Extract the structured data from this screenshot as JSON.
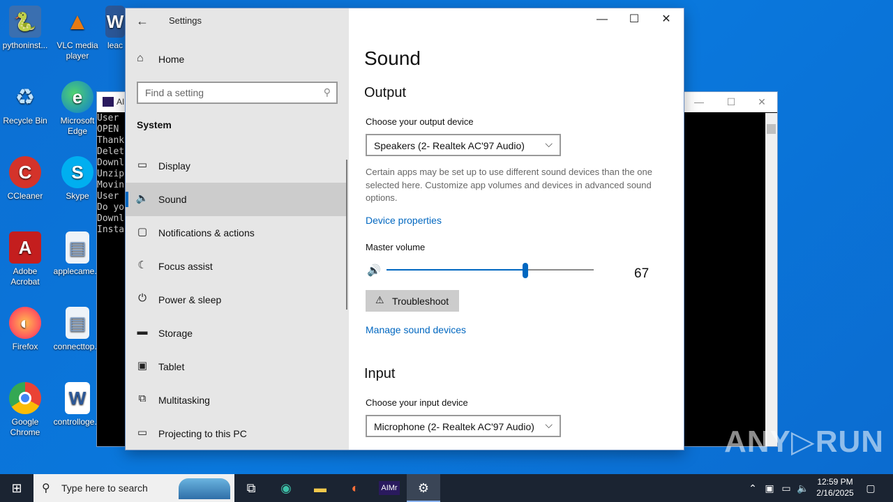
{
  "desktop": {
    "icons": [
      {
        "label": "pythoninst...",
        "glyph": "🐍",
        "color": "#3a6fb0"
      },
      {
        "label": "VLC media player",
        "glyph": "▲",
        "color": "#e87a12"
      },
      {
        "label": "leac",
        "glyph": "W",
        "color": "#2b5797"
      },
      {
        "label": "Recycle Bin",
        "glyph": "♻",
        "color": "#5aa0d8"
      },
      {
        "label": "Microsoft Edge",
        "glyph": "e",
        "color": "#1a8f7a"
      },
      {
        "label": "CCleaner",
        "glyph": "C",
        "color": "#d4332a"
      },
      {
        "label": "Skype",
        "glyph": "S",
        "color": "#00aff0"
      },
      {
        "label": "Adobe Acrobat",
        "glyph": "A",
        "color": "#c41e1e"
      },
      {
        "label": "applecame...",
        "glyph": "▤",
        "color": "#e9eef3"
      },
      {
        "label": "Firefox",
        "glyph": "🦊",
        "color": "#ff7139"
      },
      {
        "label": "connecttop...",
        "glyph": "▤",
        "color": "#e9eef3"
      },
      {
        "label": "Google Chrome",
        "glyph": "◉",
        "color": "#4285f4"
      },
      {
        "label": "controlloge...",
        "glyph": "W",
        "color": "#2b5797"
      }
    ],
    "watermark": "ANY▷RUN"
  },
  "console": {
    "title": "AI",
    "lines": [
      "User",
      "OPEN",
      "Thank",
      "Delet",
      "Downl",
      "Unzip",
      "Movin",
      "User",
      "Do yo",
      "Downl",
      "Insta"
    ]
  },
  "settings": {
    "window_title": "Settings",
    "home_label": "Home",
    "search_placeholder": "Find a setting",
    "section": "System",
    "nav_items": [
      {
        "label": "Display",
        "icon": "display-icon",
        "glyph": "▭"
      },
      {
        "label": "Sound",
        "icon": "speaker-icon",
        "glyph": "🔊",
        "selected": true
      },
      {
        "label": "Notifications & actions",
        "icon": "notification-icon",
        "glyph": "▢"
      },
      {
        "label": "Focus assist",
        "icon": "moon-icon",
        "glyph": "☾"
      },
      {
        "label": "Power & sleep",
        "icon": "power-icon",
        "glyph": "⏻"
      },
      {
        "label": "Storage",
        "icon": "storage-icon",
        "glyph": "▬"
      },
      {
        "label": "Tablet",
        "icon": "tablet-icon",
        "glyph": "▣"
      },
      {
        "label": "Multitasking",
        "icon": "multitasking-icon",
        "glyph": "⧉"
      },
      {
        "label": "Projecting to this PC",
        "icon": "projecting-icon",
        "glyph": "▭"
      }
    ],
    "page_title": "Sound",
    "output": {
      "heading": "Output",
      "device_label": "Choose your output device",
      "device_value": "Speakers (2- Realtek AC'97 Audio)",
      "description": "Certain apps may be set up to use different sound devices than the one selected here. Customize app volumes and devices in advanced sound options.",
      "device_properties_link": "Device properties",
      "master_volume_label": "Master volume",
      "master_volume_value": "67",
      "master_volume_fraction": 0.67,
      "troubleshoot_label": "Troubleshoot",
      "manage_link": "Manage sound devices"
    },
    "input": {
      "heading": "Input",
      "device_label": "Choose your input device",
      "device_value": "Microphone (2- Realtek AC'97 Audio)"
    }
  },
  "taskbar": {
    "search_placeholder": "Type here to search",
    "time": "12:59 PM",
    "date": "2/16/2025",
    "accent": "#8ab4f8"
  }
}
